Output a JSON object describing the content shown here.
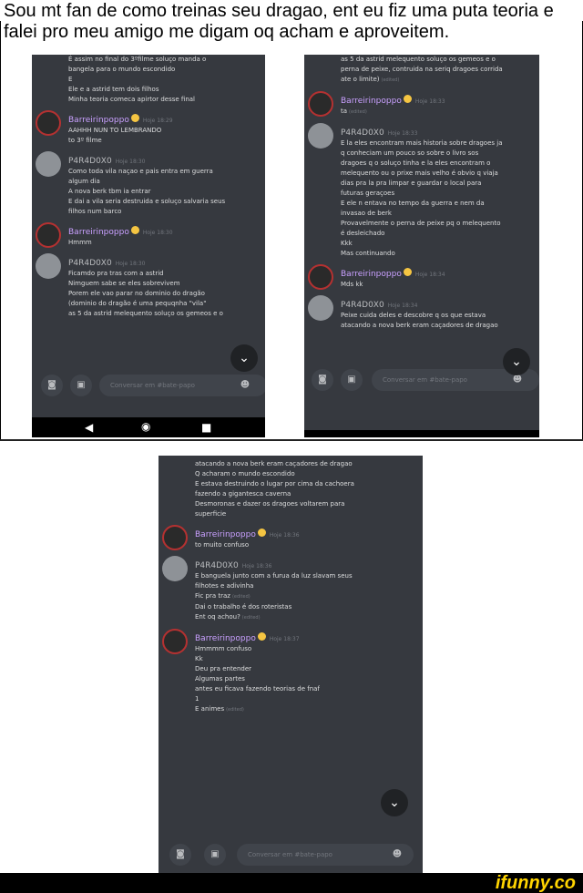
{
  "caption": "Sou mt fan de como treinas seu dragao, ent eu fiz uma puta teoria e falei pro meu amigo me digam oq acham e aproveitem.",
  "footer": {
    "logo": "ifunny.co"
  },
  "colors": {
    "background": "#36393f",
    "username_accent": "#c9a0ff",
    "text": "#dcddde"
  },
  "panel1": {
    "messages": [
      {
        "author": "",
        "time": "",
        "lines": [
          "É assim no final do 3ºfilme soluço manda o",
          "bangela para o mundo escondido",
          "E",
          "Ele e a astrid tem dois filhos",
          "Minha teoria comeca apirtor desse final"
        ]
      },
      {
        "author": "Barreirinpoppo",
        "time": "Hoje 18:29",
        "lines": [
          "AAHHH NUN TO LEMBRANDO",
          "to 3º filme"
        ]
      },
      {
        "author": "P4R4D0X0",
        "time": "Hoje 18:30",
        "lines": [
          "Como toda vila naçao e pais entra em guerra",
          "algum dia",
          "A nova berk tbm ia entrar",
          "E dai a vila seria destruida e soluço salvaria seus",
          "filhos num barco"
        ]
      },
      {
        "author": "Barreirinpoppo",
        "time": "Hoje 18:30",
        "lines": [
          "Hmmm"
        ]
      },
      {
        "author": "P4R4D0X0",
        "time": "Hoje 18:30",
        "lines": [
          "Ficamdo pra tras com a astrid",
          "Nimguem sabe se eles sobrevivem",
          "Porem ele vao parar no dominio do dragão",
          "(dominio do dragão é uma pequqnha \"vila\"",
          "as 5 da astrid melequento soluço os gemeos e o"
        ]
      }
    ],
    "input_placeholder": "Conversar em #bate-papo"
  },
  "panel2": {
    "messages": [
      {
        "author": "",
        "time": "",
        "lines": [
          "as 5 da astrid melequento soluço os gemeos e o",
          "perna de peixe, contruida na seriq dragoes corrida",
          "ate o limite)"
        ],
        "edited": "(edited)"
      },
      {
        "author": "Barreirinpoppo",
        "time": "Hoje 18:33",
        "lines": [
          "ta"
        ],
        "edited": "(edited)"
      },
      {
        "author": "P4R4D0X0",
        "time": "Hoje 18:33",
        "lines": [
          "E la eles encontram mais historia sobre dragoes ja",
          "q conheciam um pouco so sobre o livro sos",
          "dragoes q o soluço tinha e la eles encontram o",
          "melequento ou o prixe mais velho é obvio q viaja",
          "dias pra la pra limpar e guardar o local para",
          "futuras geraçoes",
          "E ele n entava no tempo da guerra e nem da",
          "invasao de berk",
          "Provavelmente o perna de peixe pq o melequento",
          "é desleichado",
          "Kkk",
          "Mas continuando"
        ]
      },
      {
        "author": "Barreirinpoppo",
        "time": "Hoje 18:34",
        "lines": [
          "Mds kk"
        ]
      },
      {
        "author": "P4R4D0X0",
        "time": "Hoje 18:34",
        "lines": [
          "Peixe cuida deles e descobre q os que estava",
          "atacando a nova berk eram caçadores de dragao"
        ]
      }
    ],
    "input_placeholder": "Conversar em #bate-papo"
  },
  "panel3": {
    "messages": [
      {
        "author": "",
        "time": "",
        "lines": [
          "atacando a nova berk eram caçadores de dragao",
          "Q acharam o mundo escondido",
          "E estava destruindo o lugar por cima da cachoera",
          "fazendo a gigantesca caverna",
          "Desmoronas e dazer os dragoes voltarem para",
          "superficie"
        ]
      },
      {
        "author": "Barreirinpoppo",
        "time": "Hoje 18:36",
        "lines": [
          "to muito confuso"
        ]
      },
      {
        "author": "P4R4D0X0",
        "time": "Hoje 18:36",
        "lines": [
          "E banguela junto com a furua da luz slavam seus",
          "filhotes e adivinha",
          "Fic pra traz",
          "Dai o trabalho é dos roteristas",
          "Ent oq achou?"
        ],
        "edited_lines": [
          2,
          4
        ]
      },
      {
        "author": "Barreirinpoppo",
        "time": "Hoje 18:37",
        "lines": [
          "Hmmmm confuso",
          "Kk",
          "Deu pra entender",
          "Algumas partes",
          "antes eu ficava fazendo teorias de fnaf",
          "1",
          "E animes"
        ],
        "edited_lines": [
          6
        ]
      }
    ],
    "edited_label": "(edited)",
    "input_placeholder": "Conversar em #bate-papo"
  },
  "icons": {
    "camera": "camera-icon",
    "gallery": "image-icon",
    "emoji": "emoji-icon",
    "scroll": "chevron-down-icon"
  }
}
